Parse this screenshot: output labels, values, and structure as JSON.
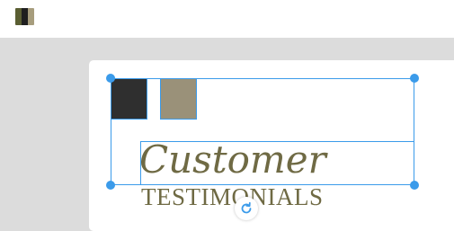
{
  "toolbar": {
    "palette_icon": "palette-swatch-icon",
    "palette_colors": [
      "#5a5e32",
      "#1f1f1f",
      "#a79d7d"
    ]
  },
  "canvas": {
    "swatches": [
      {
        "name": "dark-swatch",
        "color": "#2f2f2f"
      },
      {
        "name": "khaki-swatch",
        "color": "#9a9179"
      }
    ],
    "title_script": "Customer",
    "title_caps": "TESTIMONIALS",
    "text_color": "#6f6a44",
    "selection_color": "#3b9bea",
    "rotate_icon": "rotate-icon"
  }
}
